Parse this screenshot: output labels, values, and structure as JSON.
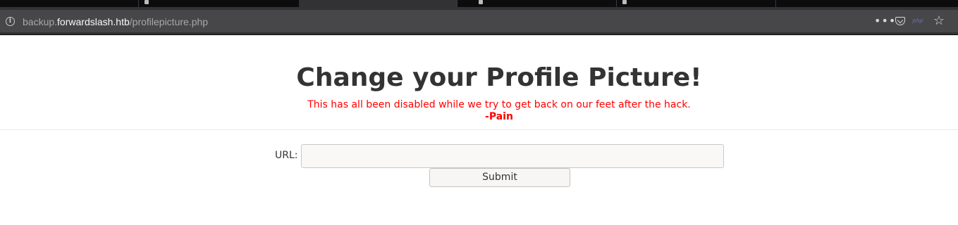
{
  "browser": {
    "url_prefix": "backup.",
    "url_host": "forwardslash.htb",
    "url_path": "/profilepicture.php",
    "info_icon": "i",
    "menu_dots": "•••",
    "php_label": "php",
    "star_glyph": "☆"
  },
  "page": {
    "title": "Change your Profile Picture!",
    "notice": "This has all been disabled while we try to get back on our feet after the hack.",
    "signature": "-Pain",
    "form": {
      "url_label": "URL:",
      "url_value": "",
      "submit_label": "Submit"
    }
  }
}
